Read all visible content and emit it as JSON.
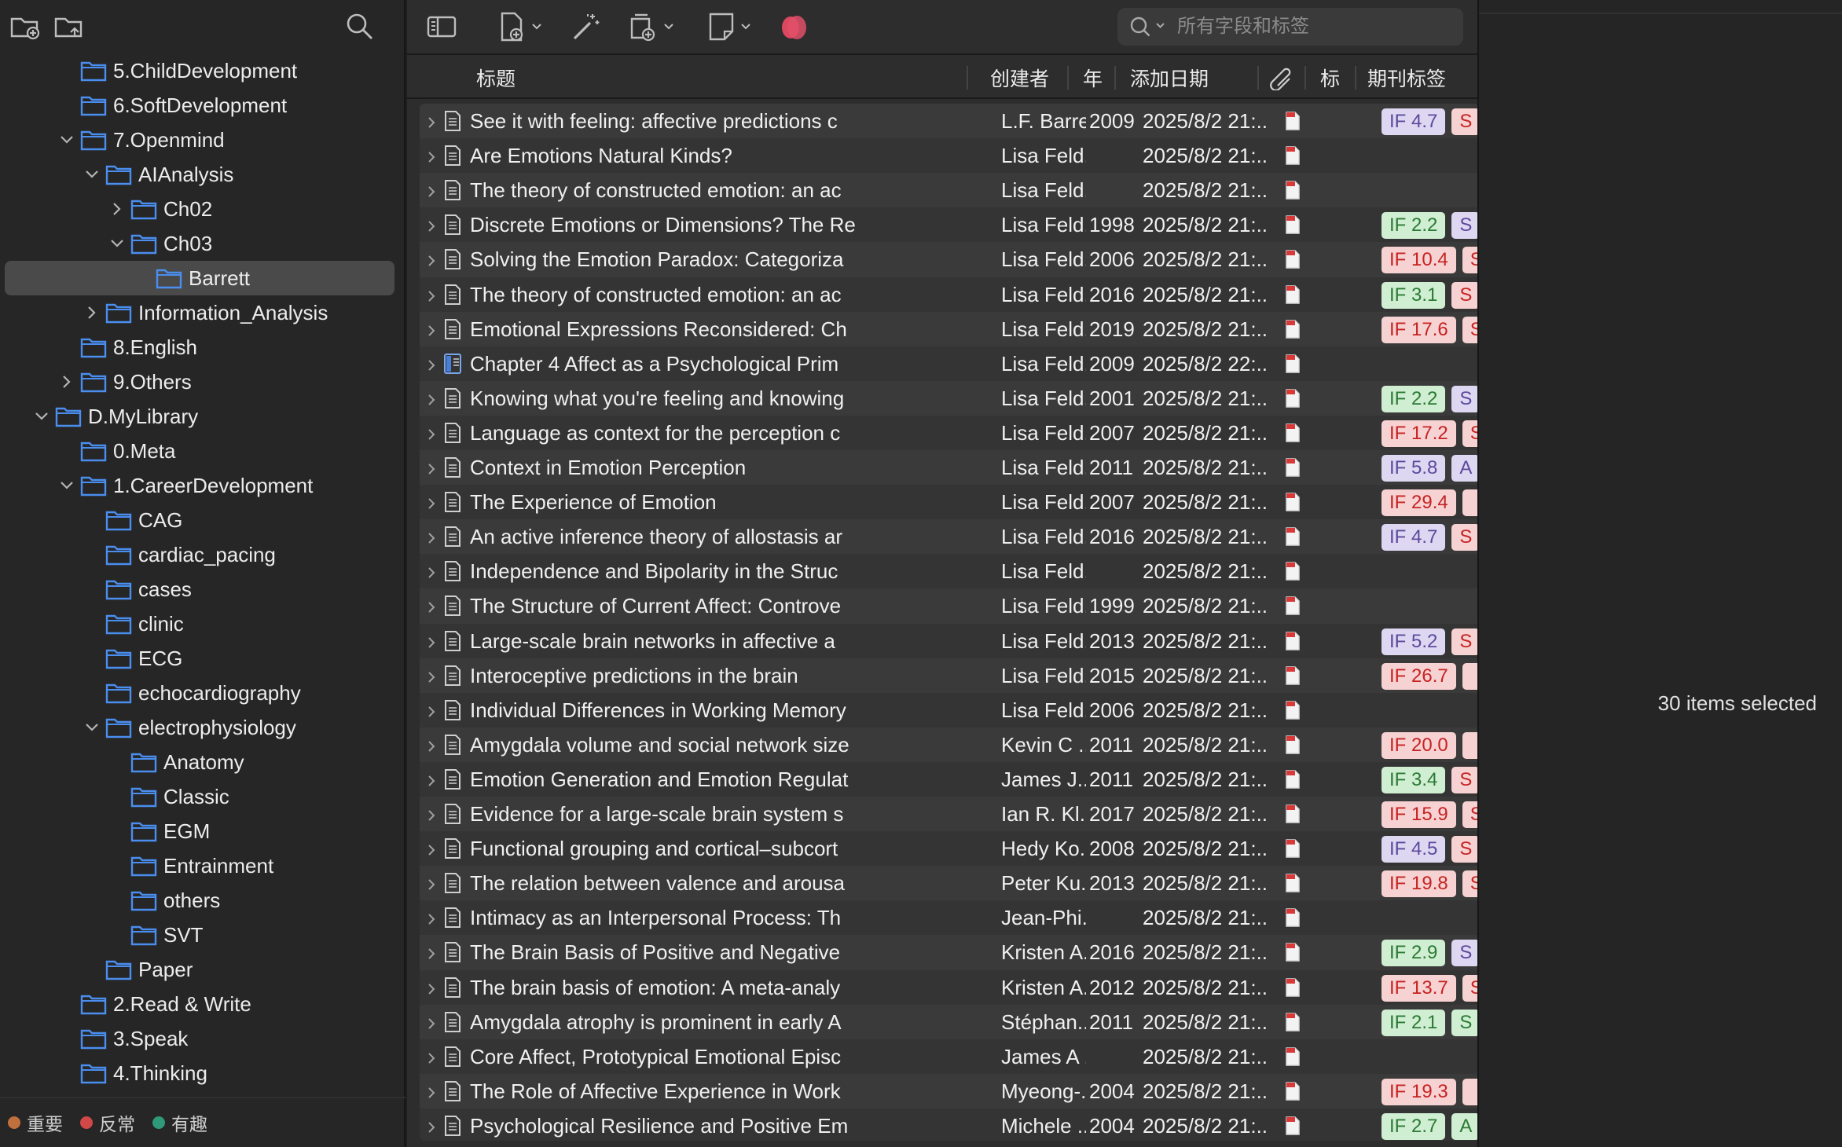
{
  "sidebar": {
    "toolbar": {
      "new_collection_icon": "folder-plus-icon",
      "new_subcollection_icon": "folder-arrow-icon",
      "search_icon": "search-icon"
    },
    "tree": [
      {
        "label": "5.ChildDevelopment",
        "depth": 2,
        "chevron": "none"
      },
      {
        "label": "6.SoftDevelopment",
        "depth": 2,
        "chevron": "none"
      },
      {
        "label": "7.Openmind",
        "depth": 2,
        "chevron": "down"
      },
      {
        "label": "AIAnalysis",
        "depth": 3,
        "chevron": "down"
      },
      {
        "label": "Ch02",
        "depth": 4,
        "chevron": "right"
      },
      {
        "label": "Ch03",
        "depth": 4,
        "chevron": "down"
      },
      {
        "label": "Barrett",
        "depth": 5,
        "chevron": "none",
        "selected": true
      },
      {
        "label": "Information_Analysis",
        "depth": 3,
        "chevron": "right"
      },
      {
        "label": "8.English",
        "depth": 2,
        "chevron": "none"
      },
      {
        "label": "9.Others",
        "depth": 2,
        "chevron": "right"
      },
      {
        "label": "D.MyLibrary",
        "depth": 1,
        "chevron": "down"
      },
      {
        "label": "0.Meta",
        "depth": 2,
        "chevron": "none"
      },
      {
        "label": "1.CareerDevelopment",
        "depth": 2,
        "chevron": "down"
      },
      {
        "label": "CAG",
        "depth": 3,
        "chevron": "none"
      },
      {
        "label": "cardiac_pacing",
        "depth": 3,
        "chevron": "none"
      },
      {
        "label": "cases",
        "depth": 3,
        "chevron": "none"
      },
      {
        "label": "clinic",
        "depth": 3,
        "chevron": "none"
      },
      {
        "label": "ECG",
        "depth": 3,
        "chevron": "none"
      },
      {
        "label": "echocardiography",
        "depth": 3,
        "chevron": "none"
      },
      {
        "label": "electrophysiology",
        "depth": 3,
        "chevron": "down"
      },
      {
        "label": "Anatomy",
        "depth": 4,
        "chevron": "none"
      },
      {
        "label": "Classic",
        "depth": 4,
        "chevron": "none"
      },
      {
        "label": "EGM",
        "depth": 4,
        "chevron": "none"
      },
      {
        "label": "Entrainment",
        "depth": 4,
        "chevron": "none"
      },
      {
        "label": "others",
        "depth": 4,
        "chevron": "none"
      },
      {
        "label": "SVT",
        "depth": 4,
        "chevron": "none"
      },
      {
        "label": "Paper",
        "depth": 3,
        "chevron": "none"
      },
      {
        "label": "2.Read & Write",
        "depth": 2,
        "chevron": "none"
      },
      {
        "label": "3.Speak",
        "depth": 2,
        "chevron": "none"
      },
      {
        "label": "4.Thinking",
        "depth": 2,
        "chevron": "none"
      }
    ],
    "tags": [
      {
        "label": "重要",
        "color": "#c0703c"
      },
      {
        "label": "反常",
        "color": "#d04848"
      },
      {
        "label": "有趣",
        "color": "#2f9a7a"
      }
    ]
  },
  "toolbar": {
    "icons": [
      "sidebar-toggle-icon",
      "new-item-icon",
      "magic-wand-icon",
      "add-attachment-icon",
      "note-icon",
      "zotero-plugin-icon"
    ],
    "search_placeholder": "所有字段和标签",
    "accent_color": "#e0506a"
  },
  "columns": {
    "title": "标题",
    "creator": "创建者",
    "year": "年",
    "date_added": "添加日期",
    "attachments_icon": "paperclip-icon",
    "extra": "标",
    "journal_tags": "期刊标签"
  },
  "items": [
    {
      "title": "See it with feeling: affective predictions c",
      "creator": "L.F. Barrett",
      "year": "2009",
      "date": "2025/8/2 21:...",
      "icon": "doc",
      "badges": [
        {
          "text": "IF 4.7",
          "color": "purple"
        },
        {
          "text": "S",
          "color": "red"
        }
      ]
    },
    {
      "title": "Are Emotions Natural Kinds?",
      "creator": "Lisa Feld...",
      "year": "",
      "date": "2025/8/2 21:...",
      "icon": "doc",
      "badges": []
    },
    {
      "title": "The theory of constructed emotion: an ac",
      "creator": "Lisa Feld...",
      "year": "",
      "date": "2025/8/2 21:...",
      "icon": "doc",
      "badges": []
    },
    {
      "title": "Discrete Emotions or Dimensions? The Re",
      "creator": "Lisa Feld...",
      "year": "1998",
      "date": "2025/8/2 21:...",
      "icon": "doc",
      "badges": [
        {
          "text": "IF 2.2",
          "color": "green"
        },
        {
          "text": "S",
          "color": "purple"
        }
      ]
    },
    {
      "title": "Solving the Emotion Paradox: Categoriza",
      "creator": "Lisa Feld...",
      "year": "2006",
      "date": "2025/8/2 21:...",
      "icon": "doc",
      "badges": [
        {
          "text": "IF 10.4",
          "color": "red"
        },
        {
          "text": "S",
          "color": "red"
        }
      ]
    },
    {
      "title": "The theory of constructed emotion: an ac",
      "creator": "Lisa Feld...",
      "year": "2016",
      "date": "2025/8/2 21:...",
      "icon": "doc",
      "badges": [
        {
          "text": "IF 3.1",
          "color": "green"
        },
        {
          "text": "S",
          "color": "red"
        }
      ]
    },
    {
      "title": "Emotional Expressions Reconsidered: Ch",
      "creator": "Lisa Feld...",
      "year": "2019",
      "date": "2025/8/2 21:...",
      "icon": "doc",
      "badges": [
        {
          "text": "IF 17.6",
          "color": "red"
        },
        {
          "text": "S",
          "color": "red"
        }
      ]
    },
    {
      "title": "Chapter 4 Affect as a Psychological Prim",
      "creator": "Lisa Feld...",
      "year": "2009",
      "date": "2025/8/2 22:...",
      "icon": "book",
      "badges": []
    },
    {
      "title": "Knowing what you're feeling and knowing",
      "creator": "Lisa Feld...",
      "year": "2001",
      "date": "2025/8/2 21:...",
      "icon": "doc",
      "badges": [
        {
          "text": "IF 2.2",
          "color": "green"
        },
        {
          "text": "S",
          "color": "purple"
        }
      ]
    },
    {
      "title": "Language as context for the perception c",
      "creator": "Lisa Feld...",
      "year": "2007",
      "date": "2025/8/2 21:...",
      "icon": "doc",
      "badges": [
        {
          "text": "IF 17.2",
          "color": "red"
        },
        {
          "text": "S",
          "color": "red"
        }
      ]
    },
    {
      "title": "Context in Emotion Perception",
      "creator": "Lisa Feld...",
      "year": "2011",
      "date": "2025/8/2 21:...",
      "icon": "doc",
      "badges": [
        {
          "text": "IF 5.8",
          "color": "purple"
        },
        {
          "text": "A",
          "color": "purple"
        }
      ]
    },
    {
      "title": "The Experience of Emotion",
      "creator": "Lisa Feld...",
      "year": "2007",
      "date": "2025/8/2 21:...",
      "icon": "doc",
      "badges": [
        {
          "text": "IF 29.4",
          "color": "red"
        },
        {
          "text": "",
          "color": "red"
        }
      ]
    },
    {
      "title": "An active inference theory of allostasis ar",
      "creator": "Lisa Feld...",
      "year": "2016",
      "date": "2025/8/2 21:...",
      "icon": "doc",
      "badges": [
        {
          "text": "IF 4.7",
          "color": "purple"
        },
        {
          "text": "S",
          "color": "red"
        }
      ]
    },
    {
      "title": "Independence and Bipolarity in the Struc",
      "creator": "Lisa Feld...",
      "year": "",
      "date": "2025/8/2 21:...",
      "icon": "doc",
      "badges": []
    },
    {
      "title": "The Structure of Current Affect: Controve",
      "creator": "Lisa Feld...",
      "year": "1999",
      "date": "2025/8/2 21:...",
      "icon": "doc",
      "badges": []
    },
    {
      "title": "Large-scale brain networks in affective a",
      "creator": "Lisa Feld...",
      "year": "2013",
      "date": "2025/8/2 21:...",
      "icon": "doc",
      "badges": [
        {
          "text": "IF 5.2",
          "color": "purple"
        },
        {
          "text": "S",
          "color": "red"
        }
      ]
    },
    {
      "title": "Interoceptive predictions in the brain",
      "creator": "Lisa Feld...",
      "year": "2015",
      "date": "2025/8/2 21:...",
      "icon": "doc",
      "badges": [
        {
          "text": "IF 26.7",
          "color": "red"
        },
        {
          "text": "",
          "color": "red"
        }
      ]
    },
    {
      "title": "Individual Differences in Working Memory",
      "creator": "Lisa Feld...",
      "year": "2006",
      "date": "2025/8/2 21:...",
      "icon": "doc",
      "badges": []
    },
    {
      "title": "Amygdala volume and social network size",
      "creator": "Kevin C ...",
      "year": "2011",
      "date": "2025/8/2 21:...",
      "icon": "doc",
      "badges": [
        {
          "text": "IF 20.0",
          "color": "red"
        },
        {
          "text": "",
          "color": "red"
        }
      ]
    },
    {
      "title": "Emotion Generation and Emotion Regulat",
      "creator": "James J....",
      "year": "2011",
      "date": "2025/8/2 21:...",
      "icon": "doc",
      "badges": [
        {
          "text": "IF 3.4",
          "color": "green"
        },
        {
          "text": "S",
          "color": "red"
        }
      ]
    },
    {
      "title": "Evidence for a large-scale brain system s",
      "creator": "Ian R. Kl...",
      "year": "2017",
      "date": "2025/8/2 21:...",
      "icon": "doc",
      "badges": [
        {
          "text": "IF 15.9",
          "color": "red"
        },
        {
          "text": "S",
          "color": "red"
        }
      ]
    },
    {
      "title": "Functional grouping and cortical–subcort",
      "creator": "Hedy Ko...",
      "year": "2008",
      "date": "2025/8/2 21:...",
      "icon": "doc",
      "badges": [
        {
          "text": "IF 4.5",
          "color": "purple"
        },
        {
          "text": "S",
          "color": "red"
        }
      ]
    },
    {
      "title": "The relation between valence and arousa",
      "creator": "Peter Ku...",
      "year": "2013",
      "date": "2025/8/2 21:...",
      "icon": "doc",
      "badges": [
        {
          "text": "IF 19.8",
          "color": "red"
        },
        {
          "text": "S",
          "color": "red"
        }
      ]
    },
    {
      "title": "Intimacy as an Interpersonal Process: Th",
      "creator": "Jean-Phi...",
      "year": "",
      "date": "2025/8/2 21:...",
      "icon": "doc",
      "badges": []
    },
    {
      "title": "The Brain Basis of Positive and Negative",
      "creator": "Kristen A...",
      "year": "2016",
      "date": "2025/8/2 21:...",
      "icon": "doc",
      "badges": [
        {
          "text": "IF 2.9",
          "color": "green"
        },
        {
          "text": "S",
          "color": "purple"
        }
      ]
    },
    {
      "title": "The brain basis of emotion: A meta-analy",
      "creator": "Kristen A...",
      "year": "2012",
      "date": "2025/8/2 21:...",
      "icon": "doc",
      "badges": [
        {
          "text": "IF 13.7",
          "color": "red"
        },
        {
          "text": "S",
          "color": "red"
        }
      ]
    },
    {
      "title": "Amygdala atrophy is prominent in early A",
      "creator": "Stéphan...",
      "year": "2011",
      "date": "2025/8/2 21:...",
      "icon": "doc",
      "badges": [
        {
          "text": "IF 2.1",
          "color": "green"
        },
        {
          "text": "S",
          "color": "green"
        }
      ]
    },
    {
      "title": "Core Affect, Prototypical Emotional Episc",
      "creator": "James A ...",
      "year": "",
      "date": "2025/8/2 21:...",
      "icon": "doc",
      "badges": []
    },
    {
      "title": "The Role of Affective Experience in Work",
      "creator": "Myeong-...",
      "year": "2004",
      "date": "2025/8/2 21:...",
      "icon": "doc",
      "badges": [
        {
          "text": "IF 19.3",
          "color": "red"
        },
        {
          "text": "",
          "color": "red"
        }
      ]
    },
    {
      "title": "Psychological Resilience and Positive Em",
      "creator": "Michele ...",
      "year": "2004",
      "date": "2025/8/2 21:...",
      "icon": "doc",
      "badges": [
        {
          "text": "IF 2.7",
          "color": "green"
        },
        {
          "text": "A",
          "color": "green"
        }
      ]
    }
  ],
  "right_pane": {
    "selected_text": "30 items selected"
  }
}
